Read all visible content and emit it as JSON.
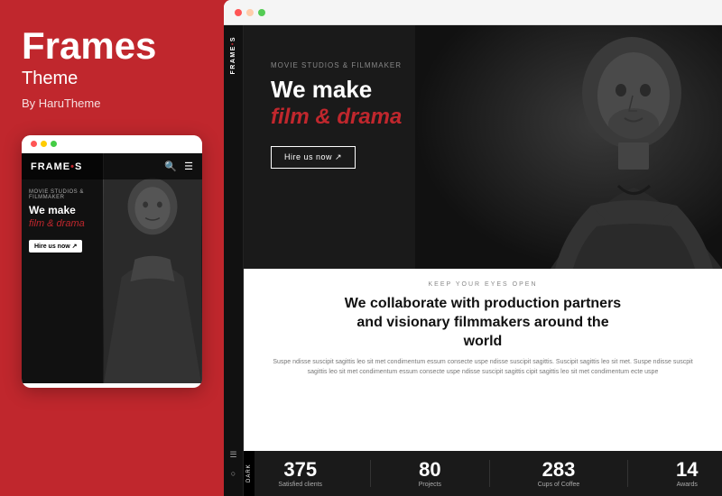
{
  "left": {
    "title": "Frames",
    "subtitle": "Theme",
    "author": "By HaruTheme"
  },
  "mobile": {
    "logo_text": "FRAME",
    "logo_dot": "•",
    "logo_s": "S",
    "tagline": "MOVIE STUDIOS & FILMMAKER",
    "headline_line1": "We make",
    "headline_italic": "film & drama",
    "cta": "Hire us now ↗",
    "dots": [
      "red",
      "yellow",
      "green"
    ]
  },
  "desktop": {
    "browser_dots": [
      "red",
      "yellow",
      "green"
    ],
    "logo_vertical": "FRAME•S",
    "tagline": "MOVIE STUDIOS & FILMMAKER",
    "headline_line1": "We make",
    "headline_italic": "film & drama",
    "cta": "Hire us now ↗",
    "section_label": "KEEP YOUR EYES OPEN",
    "section_headline": "We collaborate with production partners\nand visionary filmmakers around the\nworld",
    "section_text": "Suspe ndisse suscipit sagittis leo sit met condimentum essum consecte uspe ndisse suscipit sagittis.\nSuscipit sagittis leo sit met. Suspe ndisse suscpit sagittis leo sit met condimentum essum consecte uspe\nndisse suscipit sagittis cipit sagittis leo sit met condimentum ecte uspe",
    "dark_tab": "Dark",
    "stats": [
      {
        "number": "375",
        "label": "Satisfied clients"
      },
      {
        "number": "80",
        "label": "Projects"
      },
      {
        "number": "283",
        "label": "Cups of Coffee"
      },
      {
        "number": "14",
        "label": "Awards"
      }
    ]
  }
}
